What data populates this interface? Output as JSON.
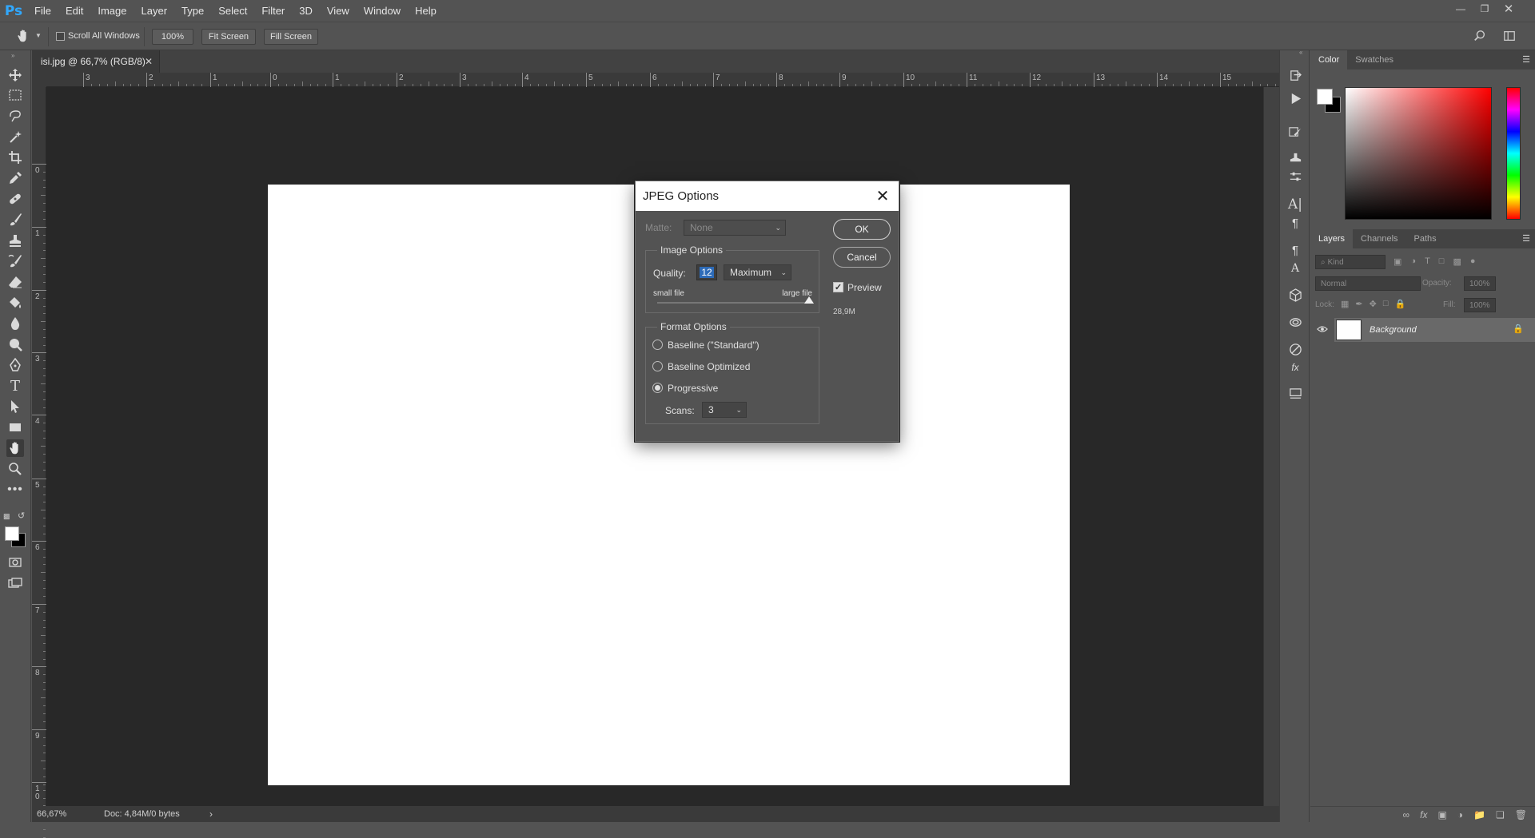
{
  "app": {
    "logo": "Ps"
  },
  "menu": [
    "File",
    "Edit",
    "Image",
    "Layer",
    "Type",
    "Select",
    "Filter",
    "3D",
    "View",
    "Window",
    "Help"
  ],
  "options": {
    "scroll_all_windows": "Scroll All Windows",
    "zoom_100": "100%",
    "fit_screen": "Fit Screen",
    "fill_screen": "Fill Screen"
  },
  "document": {
    "tab_title": "isi.jpg @ 66,7% (RGB/8)",
    "ruler_h": [
      "3",
      "2",
      "1",
      "0",
      "1",
      "2",
      "3",
      "4",
      "5",
      "6",
      "7",
      "8",
      "9",
      "10",
      "11",
      "12",
      "13",
      "14",
      "15"
    ],
    "ruler_v": [
      "0",
      "1",
      "2",
      "3",
      "4",
      "5",
      "6",
      "7",
      "8",
      "9",
      "1 0"
    ]
  },
  "status": {
    "zoom": "66,67%",
    "doc": "Doc: 4,84M/0 bytes"
  },
  "color_panel": {
    "tabs": [
      "Color",
      "Swatches"
    ]
  },
  "layers_panel": {
    "tabs": [
      "Layers",
      "Channels",
      "Paths"
    ],
    "kind_placeholder": "Kind",
    "blend_mode": "Normal",
    "opacity_label": "Opacity:",
    "opacity_value": "100%",
    "lock_label": "Lock:",
    "fill_label": "Fill:",
    "fill_value": "100%",
    "layer_name": "Background"
  },
  "dialog": {
    "title": "JPEG Options",
    "matte_label": "Matte:",
    "matte_value": "None",
    "image_options_title": "Image Options",
    "quality_label": "Quality:",
    "quality_value": "12",
    "quality_preset": "Maximum",
    "small_file": "small file",
    "large_file": "large file",
    "quality_fraction": 1.0,
    "format_options_title": "Format Options",
    "baseline_standard": "Baseline (\"Standard\")",
    "baseline_optimized": "Baseline Optimized",
    "progressive": "Progressive",
    "scans_label": "Scans:",
    "scans_value": "3",
    "ok": "OK",
    "cancel": "Cancel",
    "preview_label": "Preview",
    "file_size": "28,9M"
  }
}
